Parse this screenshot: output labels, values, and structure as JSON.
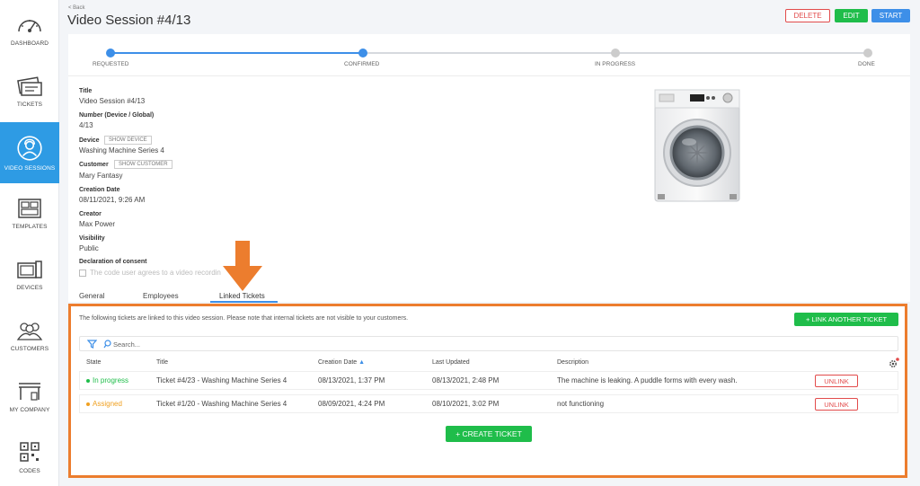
{
  "sidebar": {
    "items": [
      {
        "label": "DASHBOARD",
        "icon": "dashboard-icon"
      },
      {
        "label": "TICKETS",
        "icon": "tickets-icon"
      },
      {
        "label": "VIDEO SESSIONS",
        "icon": "video-sessions-icon",
        "active": true
      },
      {
        "label": "TEMPLATES",
        "icon": "templates-icon"
      },
      {
        "label": "DEVICES",
        "icon": "devices-icon"
      },
      {
        "label": "CUSTOMERS",
        "icon": "customers-icon"
      },
      {
        "label": "MY COMPANY",
        "icon": "my-company-icon"
      },
      {
        "label": "CODES",
        "icon": "codes-icon"
      }
    ]
  },
  "header": {
    "back": "< Back",
    "title": "Video Session #4/13",
    "delete_label": "DELETE",
    "edit_label": "EDIT",
    "start_label": "START"
  },
  "progress": {
    "steps": [
      "REQUESTED",
      "CONFIRMED",
      "IN PROGRESS",
      "DONE"
    ],
    "completed_steps": 2
  },
  "details": {
    "title_label": "Title",
    "title_value": "Video Session #4/13",
    "number_label": "Number (Device / Global)",
    "number_value": "4/13",
    "device_label": "Device",
    "show_device": "SHOW DEVICE",
    "device_value": "Washing Machine Series 4",
    "customer_label": "Customer",
    "show_customer": "SHOW CUSTOMER",
    "customer_value": "Mary Fantasy",
    "creation_label": "Creation Date",
    "creation_value": "08/11/2021, 9:26 AM",
    "creator_label": "Creator",
    "creator_value": "Max Power",
    "visibility_label": "Visibility",
    "visibility_value": "Public",
    "consent_label": "Declaration of consent",
    "consent_text": "The code user agrees to a video recordin"
  },
  "tabs": [
    {
      "label": "General"
    },
    {
      "label": "Employees"
    },
    {
      "label": "Linked Tickets",
      "active": true
    }
  ],
  "linked": {
    "info": "The following tickets are linked to this video session. Please note that internal tickets are not visible to your customers.",
    "link_button": "+ LINK ANOTHER TICKET",
    "search_placeholder": "Search...",
    "columns": [
      "State",
      "Title",
      "Creation Date",
      "Last Updated",
      "Description"
    ],
    "rows": [
      {
        "state": "In progress",
        "state_color": "#1fbd4a",
        "title": "Ticket #4/23 - Washing Machine Series 4",
        "created": "08/13/2021, 1:37 PM",
        "updated": "08/13/2021, 2:48 PM",
        "description": "The machine is leaking. A puddle forms with every wash.",
        "action": "UNLINK"
      },
      {
        "state": "Assigned",
        "state_color": "#f0a020",
        "title": "Ticket #1/20 - Washing Machine Series 4",
        "created": "08/09/2021, 4:24 PM",
        "updated": "08/10/2021, 3:02 PM",
        "description": "not functioning",
        "action": "UNLINK"
      }
    ],
    "create_button": "+ CREATE TICKET"
  },
  "colors": {
    "accent": "#3d8fe8",
    "active_nav": "#2e9be4",
    "success": "#1fbd4a",
    "danger": "#e24b4b",
    "highlight": "#ec7d2e"
  }
}
